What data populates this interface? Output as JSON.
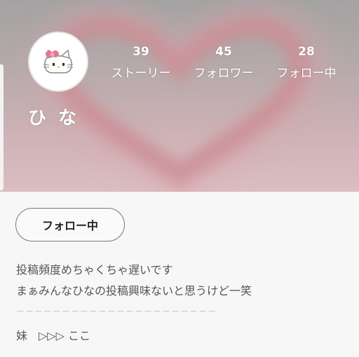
{
  "profile": {
    "username": "ひ な",
    "avatar_icon": "hello-kitty-pixel-icon"
  },
  "stats": {
    "stories": {
      "count": "39",
      "label": "ストーリー"
    },
    "followers": {
      "count": "45",
      "label": "フォロワー"
    },
    "following": {
      "count": "28",
      "label": "フォロー中"
    }
  },
  "actions": {
    "follow_label": "フォロー中"
  },
  "bio": {
    "line1": "投稿頻度めちゃくちゃ遅いです",
    "line2": "まぁみんなひなの投稿興味ないと思うけど一笑",
    "divider": "－－－－－－－－－－－－－－－－－－－－－－",
    "line3": "妹　▷▷▷ ここ"
  },
  "colors": {
    "cover_top": "#9e9e9e",
    "cover_bottom": "#e9c3c7",
    "heart": "#c98c93",
    "bow": "#e07a90"
  }
}
